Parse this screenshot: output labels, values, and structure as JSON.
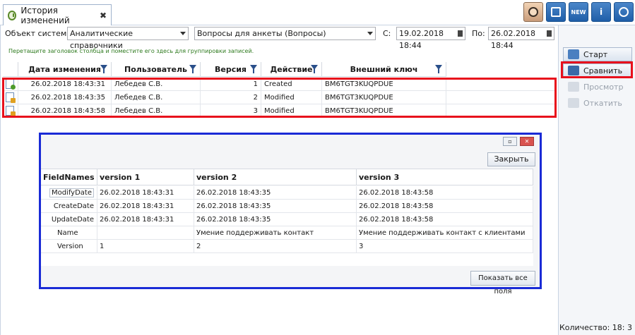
{
  "tab": {
    "title": "История изменений",
    "close": "✖",
    "icon": "history-clock-icon"
  },
  "top_icons": [
    "user-avatar-icon",
    "journal-icon",
    "new-icon",
    "info-icon",
    "power-icon"
  ],
  "top_icon_labels": {
    "new": "NEW",
    "info": "i"
  },
  "filter": {
    "object_label": "Объект системы:",
    "object_value": "Аналитические справочники",
    "subject_value": "Вопросы для анкеты (Вопросы)",
    "from_label": "С:",
    "from_value": "19.02.2018 18:44",
    "to_label": "По:",
    "to_value": "26.02.2018 18:44"
  },
  "group_hint": "Перетащите заголовок столбца и поместите его здесь для группировки записей.",
  "grid": {
    "columns": [
      "Дата изменения",
      "Пользователь",
      "Версия",
      "Действие",
      "Внешний ключ"
    ],
    "rows": [
      {
        "date": "26.02.2018 18:43:31",
        "user": "Лебедев С.В.",
        "version": "1",
        "action": "Created",
        "key": "BM6TGT3KUQPDUE"
      },
      {
        "date": "26.02.2018 18:43:35",
        "user": "Лебедев С.В.",
        "version": "2",
        "action": "Modified",
        "key": "BM6TGT3KUQPDUE"
      },
      {
        "date": "26.02.2018 18:43:58",
        "user": "Лебедев С.В.",
        "version": "3",
        "action": "Modified",
        "key": "BM6TGT3KUQPDUE"
      }
    ]
  },
  "right_panel": {
    "start": "Старт",
    "compare": "Сравнить",
    "preview": "Просмотр",
    "rollback": "Откатить",
    "count": "Количество: 18: 3"
  },
  "compare_dialog": {
    "close_button": "Закрыть",
    "show_all_button": "Показать все поля",
    "columns": [
      "FieldNames",
      "version 1",
      "version 2",
      "version 3"
    ],
    "rows": [
      {
        "field": "ModifyDate",
        "v1": "26.02.2018 18:43:31",
        "v2": "26.02.2018 18:43:35",
        "v3": "26.02.2018 18:43:58"
      },
      {
        "field": "CreateDate",
        "v1": "26.02.2018 18:43:31",
        "v2": "26.02.2018 18:43:35",
        "v3": "26.02.2018 18:43:58"
      },
      {
        "field": "UpdateDate",
        "v1": "26.02.2018 18:43:31",
        "v2": "26.02.2018 18:43:35",
        "v3": "26.02.2018 18:43:58"
      },
      {
        "field": "Name",
        "v1": "",
        "v2": "Умение поддерживать контакт",
        "v3": "Умение поддерживать контакт с клиентами"
      },
      {
        "field": "Version",
        "v1": "1",
        "v2": "2",
        "v3": "3"
      }
    ]
  },
  "colors": {
    "highlight_red": "#e8101c",
    "highlight_blue": "#1a2bd6",
    "hint_green": "#2e7a1e"
  }
}
